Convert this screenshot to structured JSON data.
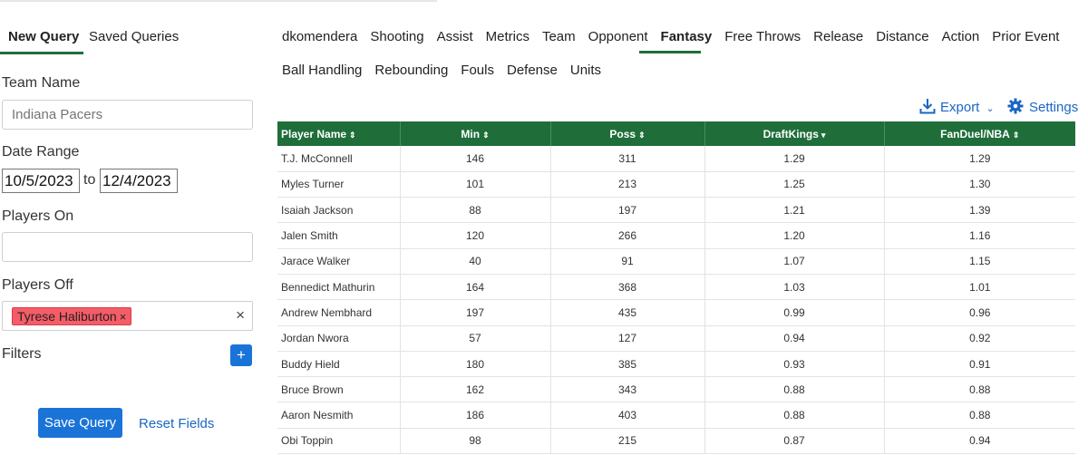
{
  "left_panel": {
    "tabs": [
      {
        "label": "New Query",
        "active": true
      },
      {
        "label": "Saved Queries",
        "active": false
      }
    ],
    "team_name": {
      "label": "Team Name",
      "placeholder": "Indiana Pacers",
      "value": ""
    },
    "date_range": {
      "label": "Date Range",
      "start": "10/5/2023",
      "separator": "to",
      "end": "12/4/2023"
    },
    "players_on": {
      "label": "Players On",
      "value": ""
    },
    "players_off": {
      "label": "Players Off",
      "chips": [
        "Tyrese Haliburton"
      ],
      "chip_remove": "×",
      "clear": "×"
    },
    "filters": {
      "label": "Filters",
      "add": "+"
    },
    "save_label": "Save Query",
    "reset_label": "Reset Fields"
  },
  "tabs_row1": [
    "dkomendera",
    "Shooting",
    "Assist",
    "Metrics",
    "Team",
    "Opponent",
    "Fantasy",
    "Free Throws",
    "Release",
    "Distance",
    "Action",
    "Prior Event"
  ],
  "tabs_row2": [
    "Ball Handling",
    "Rebounding",
    "Fouls",
    "Defense",
    "Units"
  ],
  "active_tab": "Fantasy",
  "toolbar": {
    "export_label": "Export",
    "export_caret": "⌄",
    "settings_label": "Settings"
  },
  "accent_color": "#1f6e3a",
  "link_color": "#1a66c4",
  "table": {
    "columns": [
      {
        "label": "Player Name",
        "sort": "⇕"
      },
      {
        "label": "Min",
        "sort": "⇕"
      },
      {
        "label": "Poss",
        "sort": "⇕"
      },
      {
        "label": "DraftKings",
        "sort": "▾"
      },
      {
        "label": "FanDuel/NBA",
        "sort": "⇕"
      }
    ],
    "rows": [
      [
        "T.J. McConnell",
        "146",
        "311",
        "1.29",
        "1.29"
      ],
      [
        "Myles Turner",
        "101",
        "213",
        "1.25",
        "1.30"
      ],
      [
        "Isaiah Jackson",
        "88",
        "197",
        "1.21",
        "1.39"
      ],
      [
        "Jalen Smith",
        "120",
        "266",
        "1.20",
        "1.16"
      ],
      [
        "Jarace Walker",
        "40",
        "91",
        "1.07",
        "1.15"
      ],
      [
        "Bennedict Mathurin",
        "164",
        "368",
        "1.03",
        "1.01"
      ],
      [
        "Andrew Nembhard",
        "197",
        "435",
        "0.99",
        "0.96"
      ],
      [
        "Jordan Nwora",
        "57",
        "127",
        "0.94",
        "0.92"
      ],
      [
        "Buddy Hield",
        "180",
        "385",
        "0.93",
        "0.91"
      ],
      [
        "Bruce Brown",
        "162",
        "343",
        "0.88",
        "0.88"
      ],
      [
        "Aaron Nesmith",
        "186",
        "403",
        "0.88",
        "0.88"
      ],
      [
        "Obi Toppin",
        "98",
        "215",
        "0.87",
        "0.94"
      ]
    ]
  }
}
